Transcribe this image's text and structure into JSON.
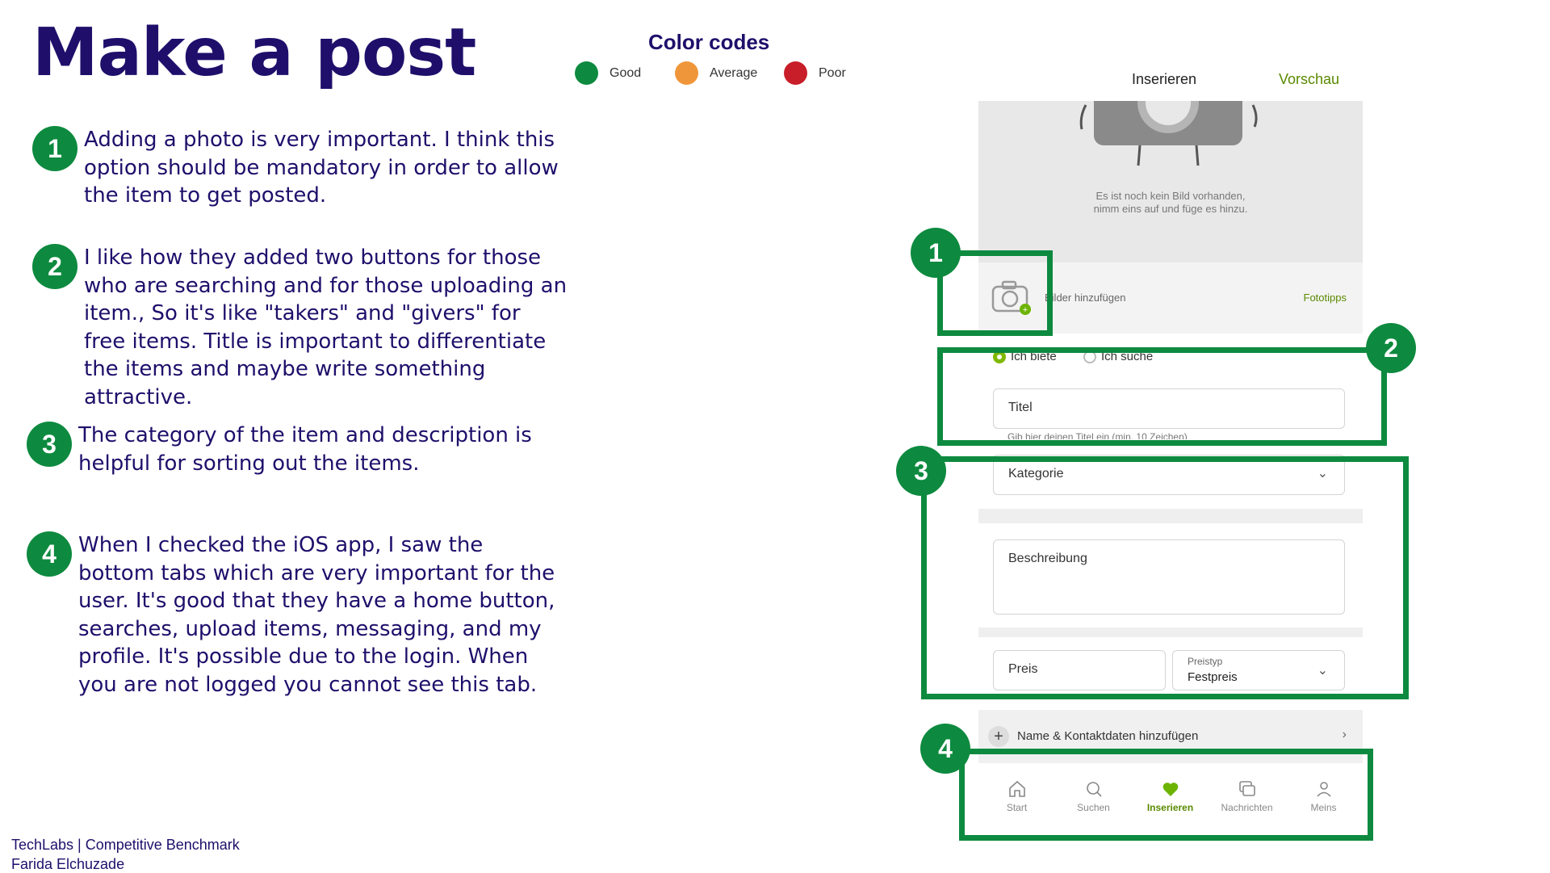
{
  "title": "Make a post",
  "legend": {
    "title": "Color codes",
    "items": [
      {
        "label": "Good",
        "color": "#0d8a3f"
      },
      {
        "label": "Average",
        "color": "#f0963a"
      },
      {
        "label": "Poor",
        "color": "#c81e2a"
      }
    ]
  },
  "notes": [
    {
      "number": "1",
      "text": "Adding a photo is very important. I think this option should be mandatory in order to allow the item to get posted."
    },
    {
      "number": "2",
      "text": "I like how they added two buttons for those who are searching and for those uploading an item., So it's like \"takers\" and \"givers\" for free items. Title is important to differentiate the items and maybe write something attractive."
    },
    {
      "number": "3",
      "text": "The category of the item and description is helpful for sorting out the items."
    },
    {
      "number": "4",
      "text": "When I checked the iOS app, I saw the bottom tabs which are very important for the user. It's good that they have a home button, searches, upload items, messaging, and my profile. It's possible due to the login. When you are not logged you cannot see this tab."
    }
  ],
  "footer": {
    "line1": "TechLabs | Competitive Benchmark",
    "line2": "Farida Elchuzade"
  },
  "phone": {
    "tab_insert": "Inserieren",
    "tab_preview": "Vorschau",
    "no_photo_line1": "Es ist noch kein Bild vorhanden,",
    "no_photo_line2": "nimm eins auf und füge es hinzu.",
    "add_photos": "Bilder hinzufügen",
    "photo_tips": "Fototipps",
    "radio_offer": "Ich biete",
    "radio_search": "Ich suche",
    "title_placeholder": "Titel",
    "title_hint": "Gib hier deinen Titel ein (min. 10 Zeichen)",
    "category": "Kategorie",
    "description": "Beschreibung",
    "price": "Preis",
    "price_type_label": "Preistyp",
    "price_type_value": "Festpreis",
    "contact": "Name & Kontaktdaten hinzufügen",
    "nav": [
      "Start",
      "Suchen",
      "Inserieren",
      "Nachrichten",
      "Meins"
    ],
    "markers": [
      "1",
      "2",
      "3",
      "4"
    ],
    "accent": "#7fb800"
  }
}
